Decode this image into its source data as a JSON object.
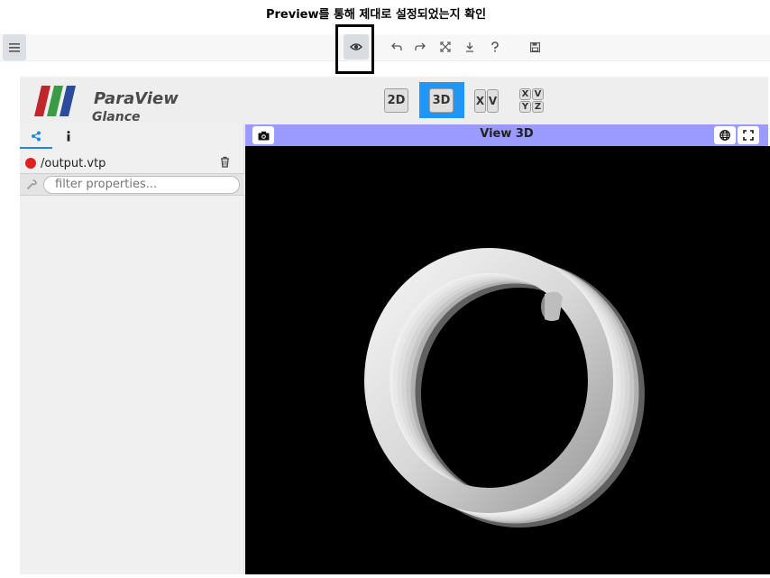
{
  "caption": "Preview를 통해 제대로 설정되었는지 확인",
  "toolbar": {
    "icons": [
      "menu-icon",
      "eye-icon",
      "undo-icon",
      "redo-icon",
      "reset-camera-icon",
      "download-icon",
      "help-icon",
      "save-icon"
    ]
  },
  "logo": {
    "line1": "ParaView",
    "line2": "Glance",
    "stripe_colors": [
      "#c0272d",
      "#3a9b44",
      "#2b4c9b"
    ]
  },
  "view_mode": {
    "btn_2d": "2D",
    "btn_3d": "3D",
    "active": "3D",
    "axis_xv": [
      "X",
      "V"
    ],
    "axis_grid": [
      "X",
      "V",
      "Y",
      "Z"
    ]
  },
  "sidebar": {
    "tabs": [
      "share-icon",
      "info-icon"
    ],
    "dataset": {
      "name": "/output.vtp",
      "color": "#e02020"
    },
    "filter_placeholder": "filter properties..."
  },
  "view": {
    "title": "View 3D",
    "header_color": "#9a9aff",
    "background": "#000000"
  },
  "accent": "#2196f3"
}
